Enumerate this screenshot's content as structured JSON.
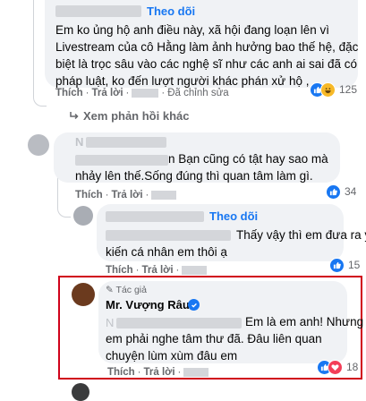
{
  "comment1": {
    "follow_label": "Theo dõi",
    "lines": [
      "Em ko ủng hộ anh điều này, xã hội đang loạn lên vì",
      "Livestream của cô Hằng làm ảnh hưởng bao thế hệ, đặc",
      "biệt là trọc sâu vào các nghệ sĩ như các anh ai sai đã có",
      "pháp luật, ko đến lượt người khác phán xử hộ ,"
    ],
    "like": "Thích",
    "reply": "Trả lời",
    "edited": "Đã chỉnh sửa",
    "reaction_count": "125"
  },
  "more_replies": "Xem phản hồi khác",
  "comment2": {
    "name_partial": "N",
    "lines": [
      "n Bạn cũng có tật hay sao mà",
      "nhảy lên thế.Sống đúng thì quan tâm làm gì."
    ],
    "like": "Thích",
    "reply": "Trả lời",
    "reaction_count": "34"
  },
  "comment3": {
    "follow_label": "Theo dõi",
    "lines": [
      "Thấy vậy thì em đưa ra ý",
      "kiến cá nhân em thôi ạ"
    ],
    "like": "Thích",
    "reply": "Trả lời",
    "reaction_count": "15"
  },
  "comment4": {
    "author_badge": "Tác giả",
    "name": "Mr. Vượng Râu",
    "mention_partial": "N",
    "lines": [
      "Em là em anh! Nhưng",
      "em phải nghe tâm thư đã. Đâu liên quan",
      "chuyện lùm xùm đâu em"
    ],
    "like": "Thích",
    "reply": "Trả lời",
    "reaction_count": "18"
  },
  "colors": {
    "link_blue": "#1877f2",
    "like_blue": "#1877f2",
    "haha_yellow": "#f7b928",
    "love_red": "#f33e58",
    "highlight_red": "#d0021b"
  }
}
